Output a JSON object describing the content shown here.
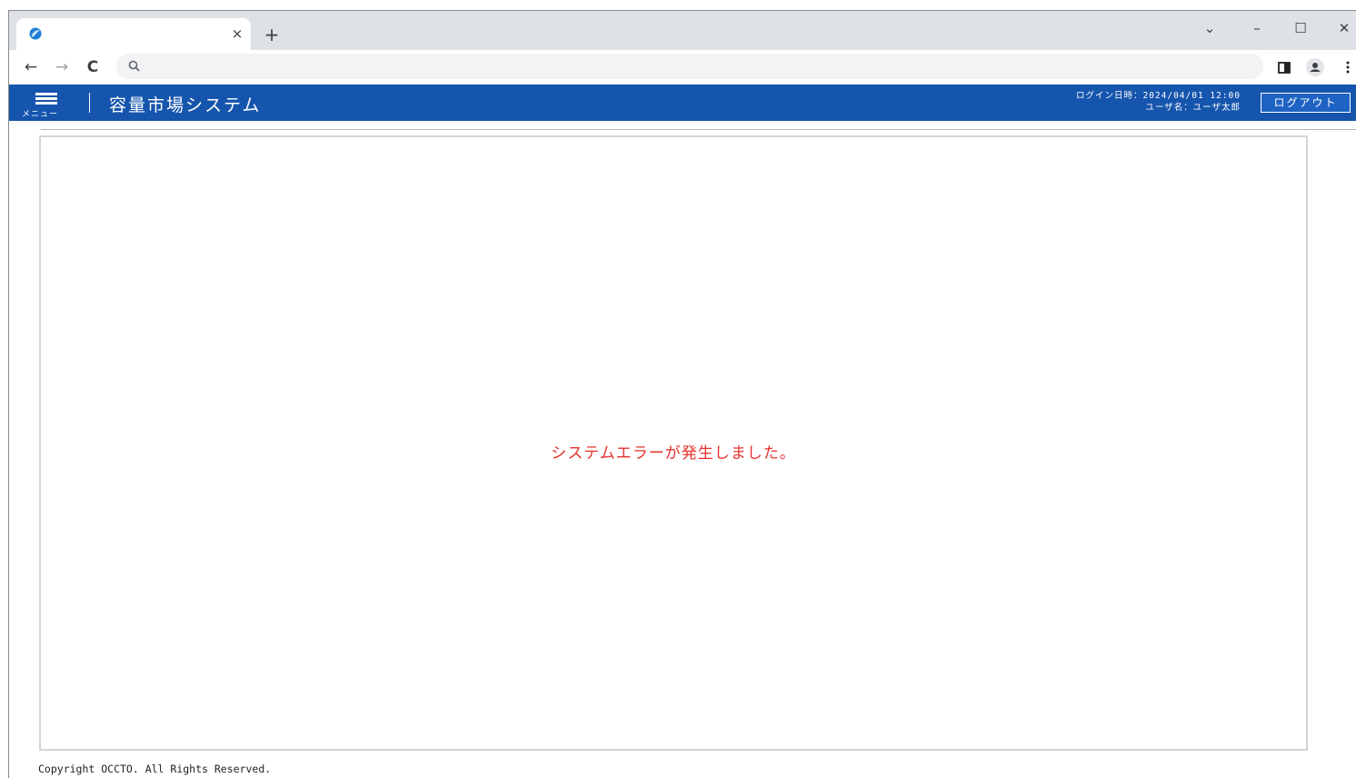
{
  "browser": {
    "tab_close": "×",
    "new_tab": "+",
    "window_controls": {
      "dropdown": "⌄",
      "minimize": "–",
      "maximize": "☐",
      "close": "✕"
    },
    "nav": {
      "back": "←",
      "forward": "→",
      "reload": "C"
    },
    "icons": [
      "app-favicon",
      "search-icon",
      "side-panel-icon",
      "profile-icon",
      "more-icon"
    ]
  },
  "header": {
    "menu_label": "メニュー",
    "title": "容量市場システム",
    "login_datetime": "ログイン日時：2024/04/01 12:00",
    "user_name": "ユーザ名：ユーザ太郎",
    "logout_label": "ログアウト",
    "brand_color": "#1555ad"
  },
  "main": {
    "error_message": "システムエラーが発生しました。",
    "error_color": "#e6312e"
  },
  "footer": {
    "copyright": "Copyright OCCTO. All Rights Reserved."
  }
}
